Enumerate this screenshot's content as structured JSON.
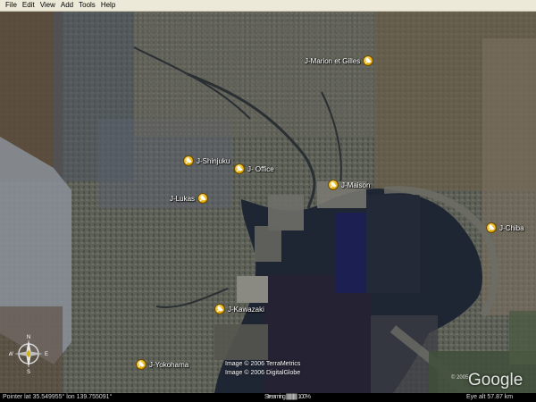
{
  "menu": [
    "File",
    "Edit",
    "View",
    "Add",
    "Tools",
    "Help"
  ],
  "placemarks": [
    {
      "id": "marion-et-gilles",
      "label": "J-Marion et Gilles"
    },
    {
      "id": "shinjuku",
      "label": "J-Shinjuku"
    },
    {
      "id": "office",
      "label": "J- Office"
    },
    {
      "id": "maison",
      "label": "J-Maison"
    },
    {
      "id": "lukas",
      "label": "J-Lukas"
    },
    {
      "id": "chiba",
      "label": "J-Chiba"
    },
    {
      "id": "kawazaki",
      "label": "J-Kawazaki"
    },
    {
      "id": "yokohama",
      "label": "J-Yokohama"
    }
  ],
  "credits": [
    "Image © 2006 TerraMetrics",
    "Image © 2006 DigitalGlobe"
  ],
  "logo": {
    "text": "Google",
    "year": "© 2005"
  },
  "compass": {
    "north": "N",
    "south": "S",
    "east": "E",
    "west": "W"
  },
  "status": {
    "pointer": "Pointer  lat   35.549955°   lon  139.755091°",
    "streaming": "Streaming |||||||||||||||  100%",
    "eye_alt": "Eye  alt    57.87 km"
  },
  "colors": {
    "pin": "#e0a800",
    "water": "#1e2533",
    "land": "#5b5e54",
    "menubar": "#ece9d8"
  }
}
